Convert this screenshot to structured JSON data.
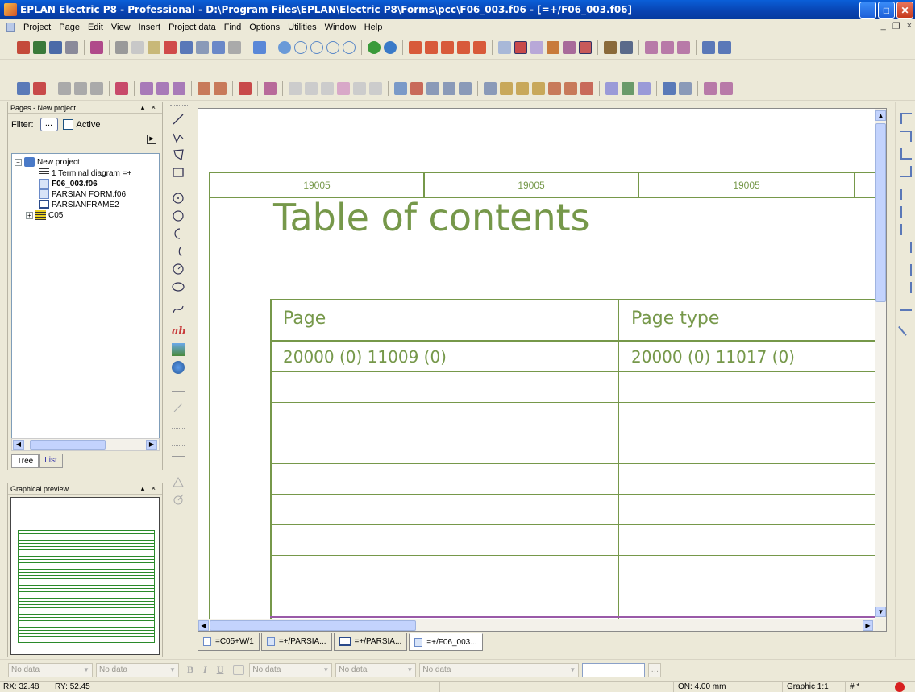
{
  "window": {
    "title": "EPLAN Electric P8 - Professional - D:\\Program Files\\EPLAN\\Electric P8\\Forms\\pcc\\F06_003.f06 - [=+/F06_003.f06]",
    "min": "_",
    "max": "□",
    "close": "✕"
  },
  "menu": {
    "items": [
      "Project",
      "Page",
      "Edit",
      "View",
      "Insert",
      "Project data",
      "Find",
      "Options",
      "Utilities",
      "Window",
      "Help"
    ],
    "mdi_min": "_",
    "mdi_restore": "❐",
    "mdi_close": "×"
  },
  "pages_panel": {
    "title": "Pages - New project",
    "controls": "▴ ×",
    "filter_label": "Filter:",
    "filter_button": "...",
    "active_label": "Active",
    "play": "▶",
    "tree": [
      {
        "label": "New project",
        "bold": false
      },
      {
        "label": "1 Terminal diagram =+",
        "bold": false
      },
      {
        "label": "F06_003.f06",
        "bold": true
      },
      {
        "label": "PARSIAN FORM.f06",
        "bold": false
      },
      {
        "label": "PARSIANFRAME2",
        "bold": false
      },
      {
        "label": "C05",
        "bold": false
      }
    ],
    "tabs": [
      "Tree",
      "List"
    ]
  },
  "preview_panel": {
    "title": "Graphical preview",
    "controls": "▴ ×"
  },
  "document": {
    "header_cells": [
      "19005",
      "19005",
      "19005"
    ],
    "title": "Table of contents",
    "columns": [
      "Page",
      "Page type"
    ],
    "rows": [
      [
        "20000 (0) 11009 (0)",
        "20000 (0) 11017 (0)"
      ]
    ]
  },
  "doc_tabs": [
    "=C05+W/1",
    "=+/PARSIA...",
    "=+/PARSIA...",
    "=+/F06_003..."
  ],
  "format_bar": {
    "combos": [
      "No data",
      "No data",
      "No data",
      "No data",
      "No data"
    ],
    "bold": "B",
    "italic": "I",
    "underline": "U"
  },
  "status": {
    "rx": "RX: 32.48",
    "ry": "RY: 52.45",
    "on": "ON: 4.00 mm",
    "graphic": "Graphic 1:1",
    "hash": "# *"
  },
  "colors": {
    "accent_green": "#76984a",
    "title_bar": "#0a5fd8"
  }
}
